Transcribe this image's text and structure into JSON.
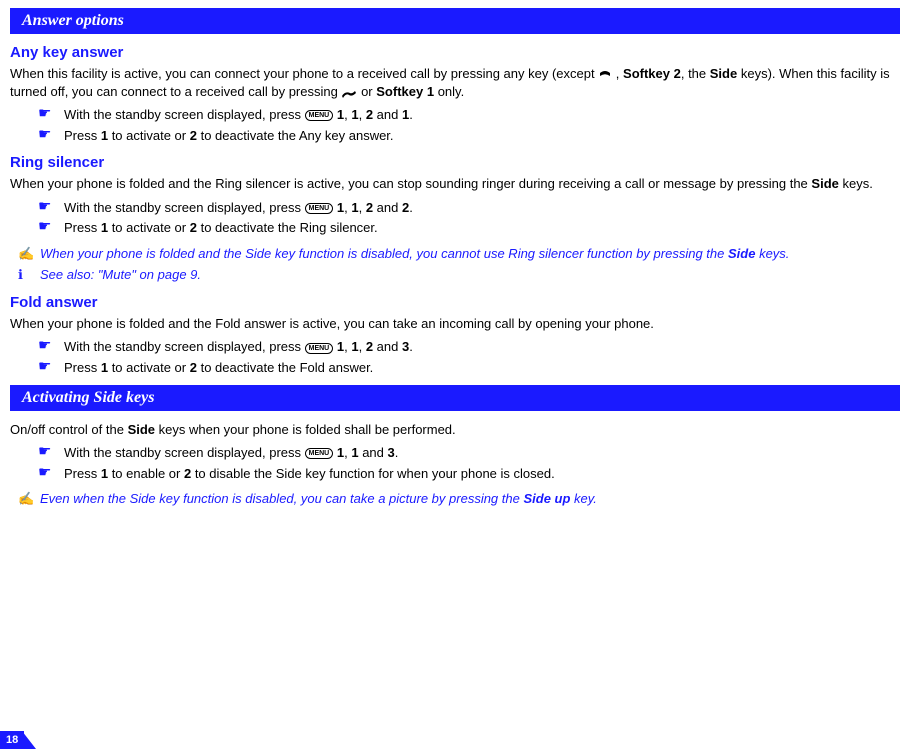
{
  "sections": {
    "answer_options": {
      "title": "Answer options",
      "any_key": {
        "heading": "Any key answer",
        "intro_a": "When this facility is active, you can connect your phone to a received call by pressing any key (except ",
        "intro_b": " , ",
        "intro_softkey2": "Softkey 2",
        "intro_c": ", the ",
        "intro_side": "Side",
        "intro_d": " keys). When this facility is turned off, you can connect to a received call by pressing ",
        "intro_e": " or ",
        "intro_softkey1": "Softkey 1",
        "intro_f": " only.",
        "step1_a": "With the standby screen displayed, press ",
        "step1_b": " ",
        "k1": "1",
        "sep": ", ",
        "k2": "1",
        "k3": "2",
        "and": " and ",
        "k4": "1",
        "dot": ".",
        "step2_a": "Press ",
        "step2_k1": "1",
        "step2_b": " to activate or ",
        "step2_k2": "2",
        "step2_c": " to deactivate the Any key answer."
      },
      "ring": {
        "heading": "Ring silencer",
        "intro_a": "When your phone is folded and the Ring silencer is active, you can stop sounding ringer during receiving a call or message by pressing the ",
        "intro_side": "Side",
        "intro_b": " keys.",
        "step1_a": "With the standby screen displayed, press ",
        "k1": "1",
        "k2": "1",
        "k3": "2",
        "k4": "2",
        "step2_a": "Press ",
        "step2_k1": "1",
        "step2_b": " to activate or ",
        "step2_k2": "2",
        "step2_c": " to deactivate the Ring silencer.",
        "note1_a": "When your phone is folded and the Side key function is disabled, you cannot use Ring silencer function by pressing the ",
        "note1_b": "Side",
        "note1_c": " keys.",
        "note2": "See also: \"Mute\" on page 9."
      },
      "fold": {
        "heading": "Fold answer",
        "intro": "When your phone is folded and the Fold answer is active, you can take an incoming call by opening your phone.",
        "step1_a": "With the standby screen displayed, press ",
        "k1": "1",
        "k2": "1",
        "k3": "2",
        "k4": "3",
        "step2_a": "Press ",
        "step2_k1": "1",
        "step2_b": " to activate or ",
        "step2_k2": "2",
        "step2_c": " to deactivate the Fold answer."
      }
    },
    "side_keys": {
      "title": "Activating Side keys",
      "intro_a": "On/off control of the ",
      "intro_side": "Side",
      "intro_b": " keys when your phone is folded shall be performed.",
      "step1_a": "With the standby screen displayed, press ",
      "k1": "1",
      "k2": "1",
      "k3": "3",
      "step2_a": "Press ",
      "step2_k1": "1",
      "step2_b": " to enable or ",
      "step2_k2": "2",
      "step2_c": " to disable the Side key function for when your phone is closed.",
      "note_a": "Even when the Side key function is disabled, you can take a picture by pressing the ",
      "note_b": "Side up",
      "note_c": " key."
    }
  },
  "page_number": "18",
  "menu_label": "MENU"
}
